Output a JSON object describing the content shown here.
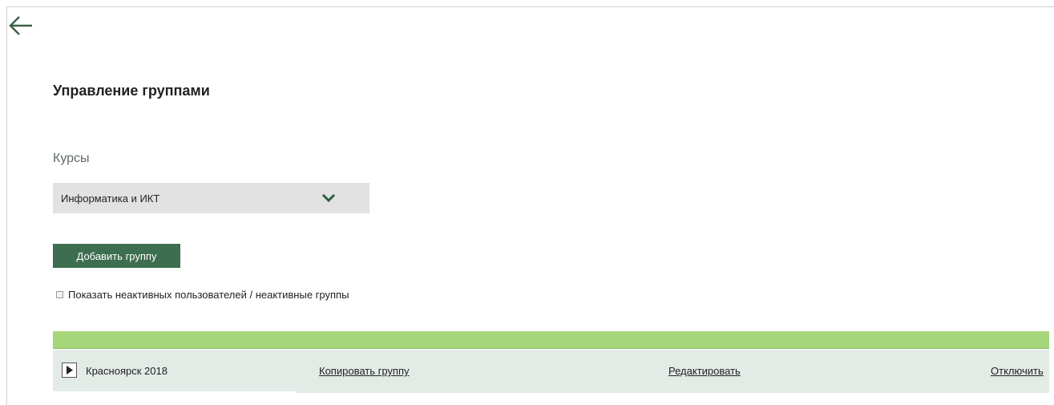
{
  "header": {
    "back_icon": "arrow-left-icon",
    "title": "Управление группами"
  },
  "courses": {
    "label": "Курсы",
    "selected": "Информатика и ИКТ",
    "chevron_icon": "chevron-down-icon"
  },
  "actions": {
    "add_group_label": "Добавить группу"
  },
  "filters": {
    "show_inactive_label": "Показать неактивных пользователей / неактивные группы",
    "show_inactive_checked": false
  },
  "groups": [
    {
      "name": "Красноярск 2018",
      "expand_icon": "play-triangle-icon",
      "copy_label": "Копировать группу",
      "edit_label": "Редактировать",
      "disable_label": "Отключить"
    }
  ],
  "colors": {
    "accent_dark_green": "#3e6e50",
    "table_header_green": "#a6d67c",
    "row_background": "#e3ebe7",
    "select_background": "#e2e2e2",
    "label_gray_green": "#5e6b63"
  }
}
